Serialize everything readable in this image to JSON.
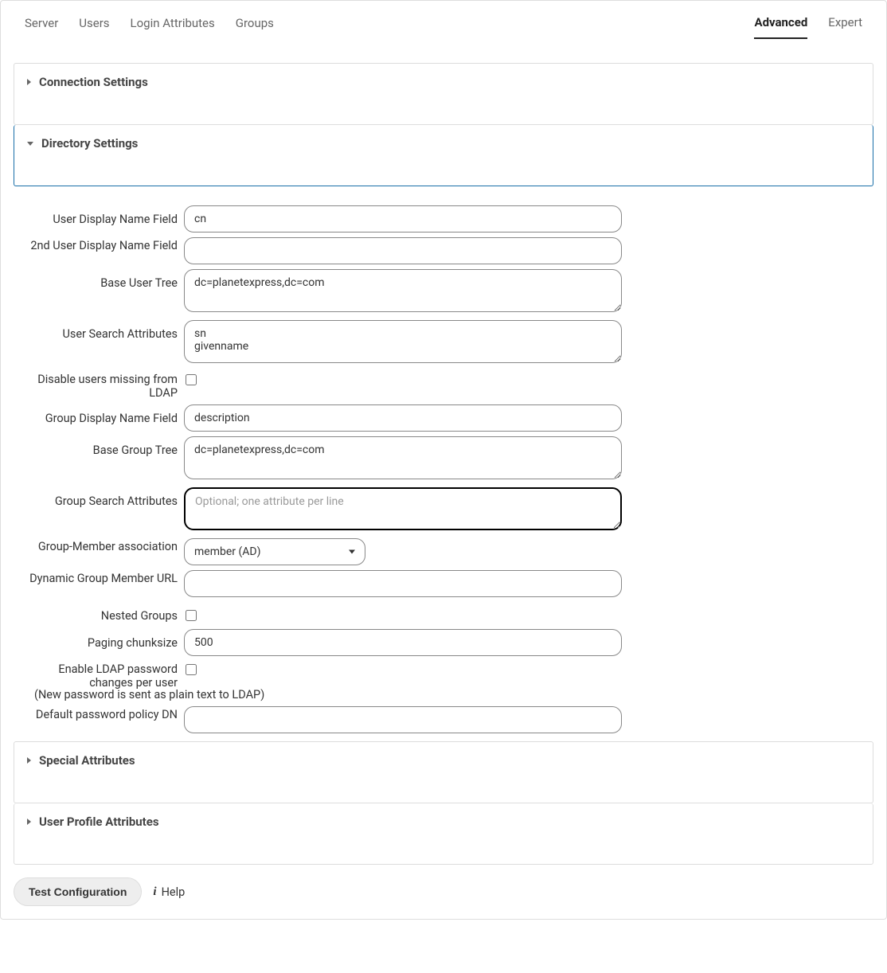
{
  "tabs": {
    "left": [
      {
        "label": "Server"
      },
      {
        "label": "Users"
      },
      {
        "label": "Login Attributes"
      },
      {
        "label": "Groups"
      }
    ],
    "right": [
      {
        "label": "Advanced",
        "active": true
      },
      {
        "label": "Expert",
        "active": false
      }
    ]
  },
  "accordions": {
    "connection": {
      "title": "Connection Settings"
    },
    "directory": {
      "title": "Directory Settings"
    },
    "special": {
      "title": "Special Attributes"
    },
    "profile": {
      "title": "User Profile Attributes"
    }
  },
  "fields": {
    "user_display_name": {
      "label": "User Display Name Field",
      "value": "cn"
    },
    "second_user_display_name": {
      "label": "2nd User Display Name Field",
      "value": ""
    },
    "base_user_tree": {
      "label": "Base User Tree",
      "value": "dc=planetexpress,dc=com"
    },
    "user_search_attributes": {
      "label": "User Search Attributes",
      "value": "sn\ngivenname"
    },
    "disable_missing": {
      "label": "Disable users missing from LDAP",
      "checked": false
    },
    "group_display_name": {
      "label": "Group Display Name Field",
      "value": "description"
    },
    "base_group_tree": {
      "label": "Base Group Tree",
      "value": "dc=planetexpress,dc=com"
    },
    "group_search_attributes": {
      "label": "Group Search Attributes",
      "value": "",
      "placeholder": "Optional; one attribute per line"
    },
    "group_member_assoc": {
      "label": "Group-Member association",
      "value": "member (AD)"
    },
    "dynamic_group_url": {
      "label": "Dynamic Group Member URL",
      "value": ""
    },
    "nested_groups": {
      "label": "Nested Groups",
      "checked": false
    },
    "paging_chunksize": {
      "label": "Paging chunksize",
      "value": "500"
    },
    "enable_password_change": {
      "label": "Enable LDAP password changes per user",
      "checked": false,
      "hint": "(New password is sent as plain text to LDAP)"
    },
    "default_password_policy": {
      "label": "Default password policy DN",
      "value": ""
    }
  },
  "footer": {
    "test_button": "Test Configuration",
    "help_label": "Help"
  }
}
